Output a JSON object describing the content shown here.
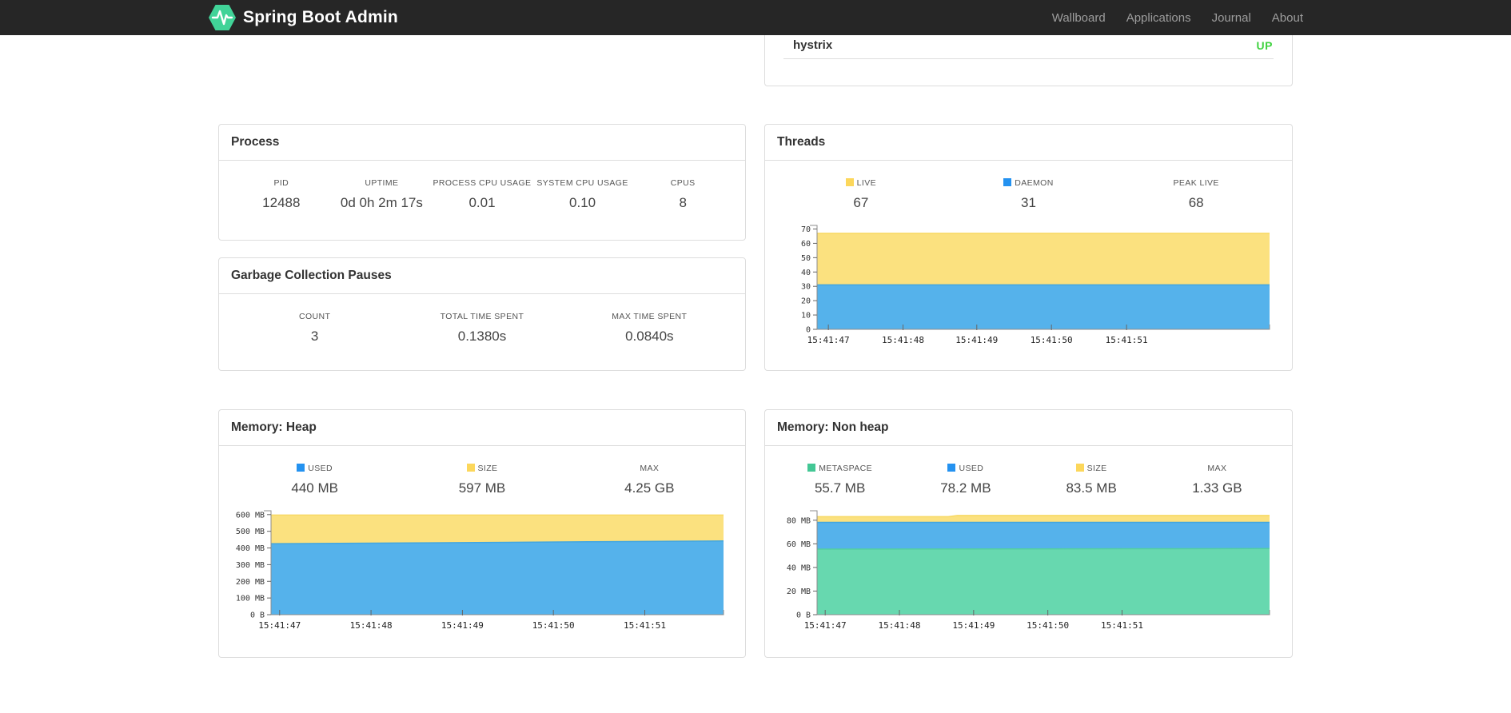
{
  "navbar": {
    "brand": "Spring Boot Admin",
    "items": [
      {
        "label": "Wallboard"
      },
      {
        "label": "Applications"
      },
      {
        "label": "Journal"
      },
      {
        "label": "About"
      }
    ]
  },
  "colors": {
    "navbar_bg": "#262626",
    "logo_green": "#41d398",
    "status_up": "#3fd23f",
    "panel_border": "#dddddd",
    "area_blue": "#55b2eb",
    "area_yellow": "#fbe17f",
    "area_green": "#67d8af",
    "legend_blue": "#2492f0",
    "legend_yellow": "#fcd75b",
    "legend_green": "#43c795"
  },
  "application_panel": {
    "name": "hystrix",
    "status": "UP"
  },
  "panels": {
    "process": {
      "title": "Process",
      "stats": [
        {
          "label": "PID",
          "value": "12488"
        },
        {
          "label": "UPTIME",
          "value": "0d 0h 2m 17s"
        },
        {
          "label": "PROCESS CPU USAGE",
          "value": "0.01"
        },
        {
          "label": "SYSTEM CPU USAGE",
          "value": "0.10"
        },
        {
          "label": "CPUS",
          "value": "8"
        }
      ]
    },
    "gc": {
      "title": "Garbage Collection Pauses",
      "stats": [
        {
          "label": "COUNT",
          "value": "3"
        },
        {
          "label": "TOTAL TIME SPENT",
          "value": "0.1380s"
        },
        {
          "label": "MAX TIME SPENT",
          "value": "0.0840s"
        }
      ]
    },
    "threads": {
      "title": "Threads",
      "stats": [
        {
          "label": "LIVE",
          "value": "67",
          "color": "#fcd75b"
        },
        {
          "label": "DAEMON",
          "value": "31",
          "color": "#2492f0"
        },
        {
          "label": "PEAK LIVE",
          "value": "68"
        }
      ]
    },
    "heap": {
      "title": "Memory: Heap",
      "stats": [
        {
          "label": "USED",
          "value": "440 MB",
          "color": "#2492f0"
        },
        {
          "label": "SIZE",
          "value": "597 MB",
          "color": "#fcd75b"
        },
        {
          "label": "MAX",
          "value": "4.25 GB"
        }
      ]
    },
    "nonheap": {
      "title": "Memory: Non heap",
      "stats": [
        {
          "label": "METASPACE",
          "value": "55.7 MB",
          "color": "#43c795"
        },
        {
          "label": "USED",
          "value": "78.2 MB",
          "color": "#2492f0"
        },
        {
          "label": "SIZE",
          "value": "83.5 MB",
          "color": "#fcd75b"
        },
        {
          "label": "MAX",
          "value": "1.33 GB"
        }
      ]
    }
  },
  "chart_data": [
    {
      "id": "threads",
      "type": "area",
      "title": "Threads",
      "x_labels": [
        "15:41:47",
        "15:41:48",
        "15:41:49",
        "15:41:50",
        "15:41:51"
      ],
      "x_tick_fracs": [
        0.025,
        0.19,
        0.353,
        0.518,
        0.684
      ],
      "y_ticks": [
        {
          "label": "0",
          "value": 0
        },
        {
          "label": "10",
          "value": 10
        },
        {
          "label": "20",
          "value": 20
        },
        {
          "label": "30",
          "value": 30
        },
        {
          "label": "40",
          "value": 40
        },
        {
          "label": "50",
          "value": 50
        },
        {
          "label": "60",
          "value": 60
        },
        {
          "label": "70",
          "value": 70
        }
      ],
      "ymax_plot": 72.5,
      "legend_position": "top",
      "grid": false,
      "series": [
        {
          "name": "LIVE",
          "color": "#fbe17f",
          "line": "#f8d964",
          "points": [
            [
              0,
              67
            ],
            [
              1,
              67
            ]
          ]
        },
        {
          "name": "DAEMON",
          "color": "#55b2eb",
          "line": "#42a6e0",
          "points": [
            [
              0,
              31
            ],
            [
              1,
              31
            ]
          ]
        }
      ]
    },
    {
      "id": "heap",
      "type": "area",
      "title": "Memory: Heap",
      "x_labels": [
        "15:41:47",
        "15:41:48",
        "15:41:49",
        "15:41:50",
        "15:41:51"
      ],
      "x_tick_fracs": [
        0.019,
        0.221,
        0.423,
        0.624,
        0.826
      ],
      "y_ticks": [
        {
          "label": "0 B",
          "value": 0
        },
        {
          "label": "100 MB",
          "value": 100
        },
        {
          "label": "200 MB",
          "value": 200
        },
        {
          "label": "300 MB",
          "value": 300
        },
        {
          "label": "400 MB",
          "value": 400
        },
        {
          "label": "500 MB",
          "value": 500
        },
        {
          "label": "600 MB",
          "value": 600
        }
      ],
      "ymax_plot": 623,
      "legend_position": "top",
      "grid": false,
      "series": [
        {
          "name": "SIZE",
          "color": "#fbe17f",
          "line": "#f8d964",
          "points": [
            [
              0,
              597
            ],
            [
              1,
              597
            ]
          ]
        },
        {
          "name": "USED",
          "color": "#55b2eb",
          "line": "#42a6e0",
          "points": [
            [
              0,
              425
            ],
            [
              0.35,
              431
            ],
            [
              0.7,
              437
            ],
            [
              1,
              442
            ]
          ]
        }
      ]
    },
    {
      "id": "nonheap",
      "type": "area",
      "title": "Memory: Non heap",
      "x_labels": [
        "15:41:47",
        "15:41:48",
        "15:41:49",
        "15:41:50",
        "15:41:51"
      ],
      "x_tick_fracs": [
        0.018,
        0.182,
        0.346,
        0.51,
        0.674
      ],
      "y_ticks": [
        {
          "label": "0 B",
          "value": 0
        },
        {
          "label": "20 MB",
          "value": 20
        },
        {
          "label": "40 MB",
          "value": 40
        },
        {
          "label": "60 MB",
          "value": 60
        },
        {
          "label": "80 MB",
          "value": 80
        }
      ],
      "ymax_plot": 88,
      "legend_position": "top",
      "grid": false,
      "series": [
        {
          "name": "SIZE",
          "color": "#fbe17f",
          "line": "#f8d964",
          "points": [
            [
              0,
              83
            ],
            [
              0.29,
              83
            ],
            [
              0.31,
              84
            ],
            [
              1,
              84
            ]
          ]
        },
        {
          "name": "USED",
          "color": "#55b2eb",
          "line": "#42a6e0",
          "points": [
            [
              0,
              78.2
            ],
            [
              1,
              78.2
            ]
          ]
        },
        {
          "name": "METASPACE",
          "color": "#67d8af",
          "line": "#52cfa0",
          "points": [
            [
              0,
              55.5
            ],
            [
              1,
              56
            ]
          ]
        }
      ]
    }
  ]
}
